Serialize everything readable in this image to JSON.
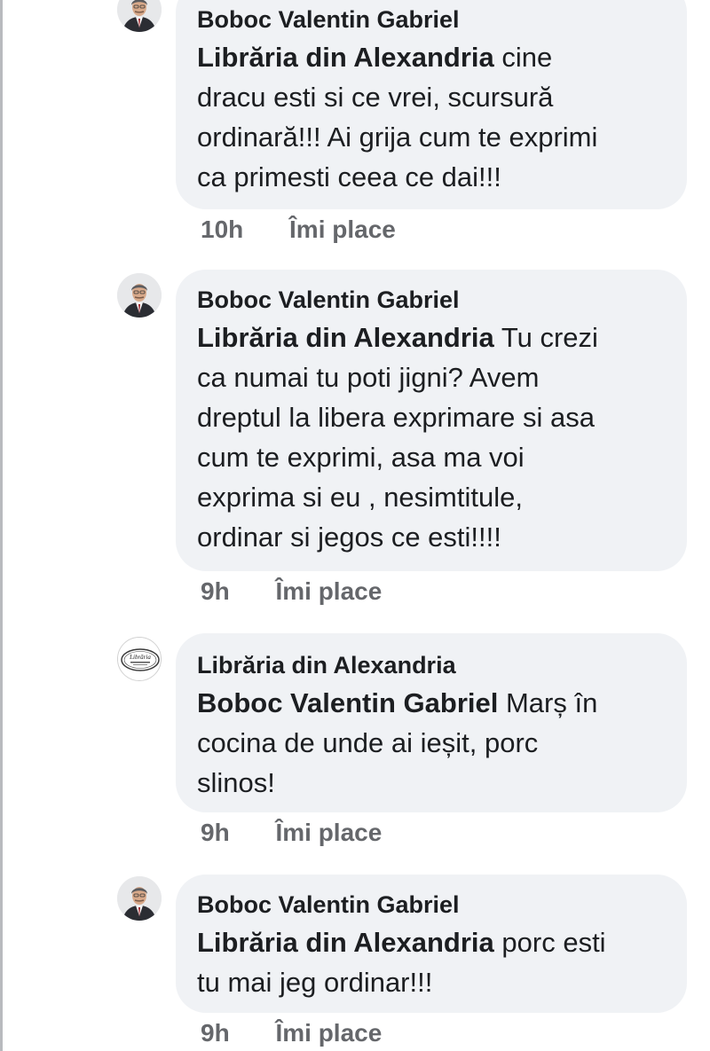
{
  "comments": [
    {
      "author": "Boboc Valentin Gabriel",
      "mention": "Librăria din Alexandria",
      "lines": [
        "cine",
        "dracu esti si ce vrei, scursură",
        "ordinară!!! Ai grija cum te exprimi",
        "ca primesti ceea ce dai!!!"
      ],
      "time": "10h",
      "like_label": "Îmi place",
      "avatar_icon": "person-in-suit-avatar-icon"
    },
    {
      "author": "Boboc Valentin Gabriel",
      "mention": "Librăria din Alexandria",
      "lines": [
        "Tu crezi",
        "ca numai tu poti jigni? Avem",
        "dreptul la libera exprimare si asa",
        "cum te exprimi, asa ma voi",
        "exprima si eu , nesimtitule,",
        "ordinar si jegos ce esti!!!!"
      ],
      "time": "9h",
      "like_label": "Îmi place",
      "avatar_icon": "person-in-suit-avatar-icon"
    },
    {
      "author": "Librăria din Alexandria",
      "mention": "Boboc Valentin Gabriel",
      "lines": [
        "Marș în",
        "cocina de unde ai ieșit, porc",
        "slinos!"
      ],
      "time": "9h",
      "like_label": "Îmi place",
      "avatar_icon": "bookstore-logo-icon",
      "logo_text": "Librăria"
    },
    {
      "author": "Boboc Valentin Gabriel",
      "mention": "Librăria din Alexandria",
      "lines": [
        "porc esti",
        "tu mai jeg ordinar!!!"
      ],
      "time": "9h",
      "like_label": "Îmi place",
      "avatar_icon": "person-in-suit-avatar-icon"
    }
  ],
  "colors": {
    "bubble_bg": "#f0f2f5",
    "text": "#1c1e21",
    "meta_text": "#65676b",
    "suit": "#2b2d33",
    "tie": "#9a1c22"
  }
}
